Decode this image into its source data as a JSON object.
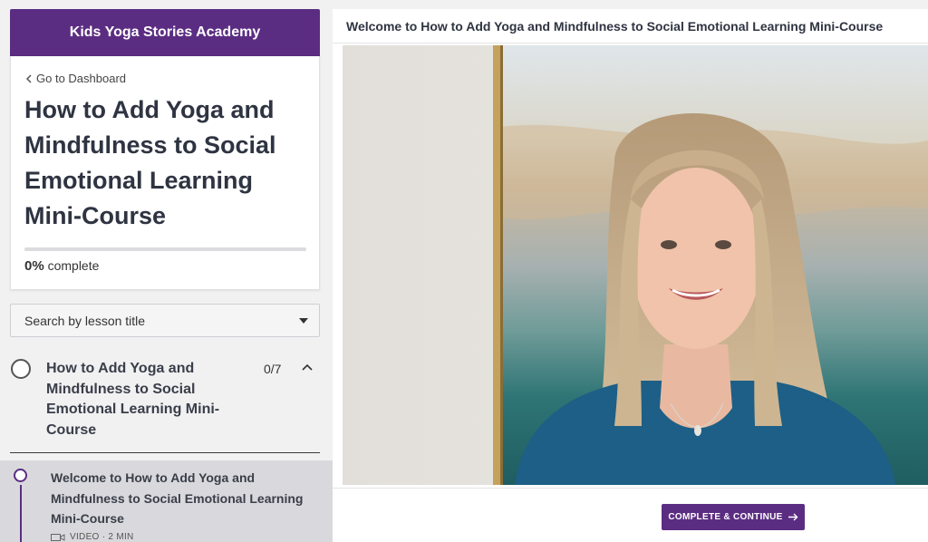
{
  "sidebar": {
    "brand": "Kids Yoga Stories Academy",
    "back_link": "Go to Dashboard",
    "course_title": "How to Add Yoga and Mindfulness to Social Emotional Learning Mini-Course",
    "progress": {
      "value": 0,
      "percent_label": "0%",
      "suffix": "complete"
    },
    "search": {
      "label": "Search by lesson title"
    },
    "chapter": {
      "title": "How to Add Yoga and Mindfulness to Social Emotional Learning Mini-Course",
      "count": "0/7"
    },
    "lesson": {
      "title": "Welcome to How to Add Yoga and Mindfulness to Social Emotional Learning Mini-Course",
      "meta": "VIDEO · 2 MIN"
    }
  },
  "main": {
    "lesson_title": "Welcome to How to Add Yoga and Mindfulness to Social Emotional Learning Mini-Course",
    "complete_button": "COMPLETE & CONTINUE"
  },
  "colors": {
    "accent": "#5b2d82",
    "background": "#f1f1f2"
  },
  "icons": [
    "chevron-left-icon",
    "caret-down-icon",
    "chevron-up-icon",
    "video-icon",
    "arrow-right-icon"
  ]
}
